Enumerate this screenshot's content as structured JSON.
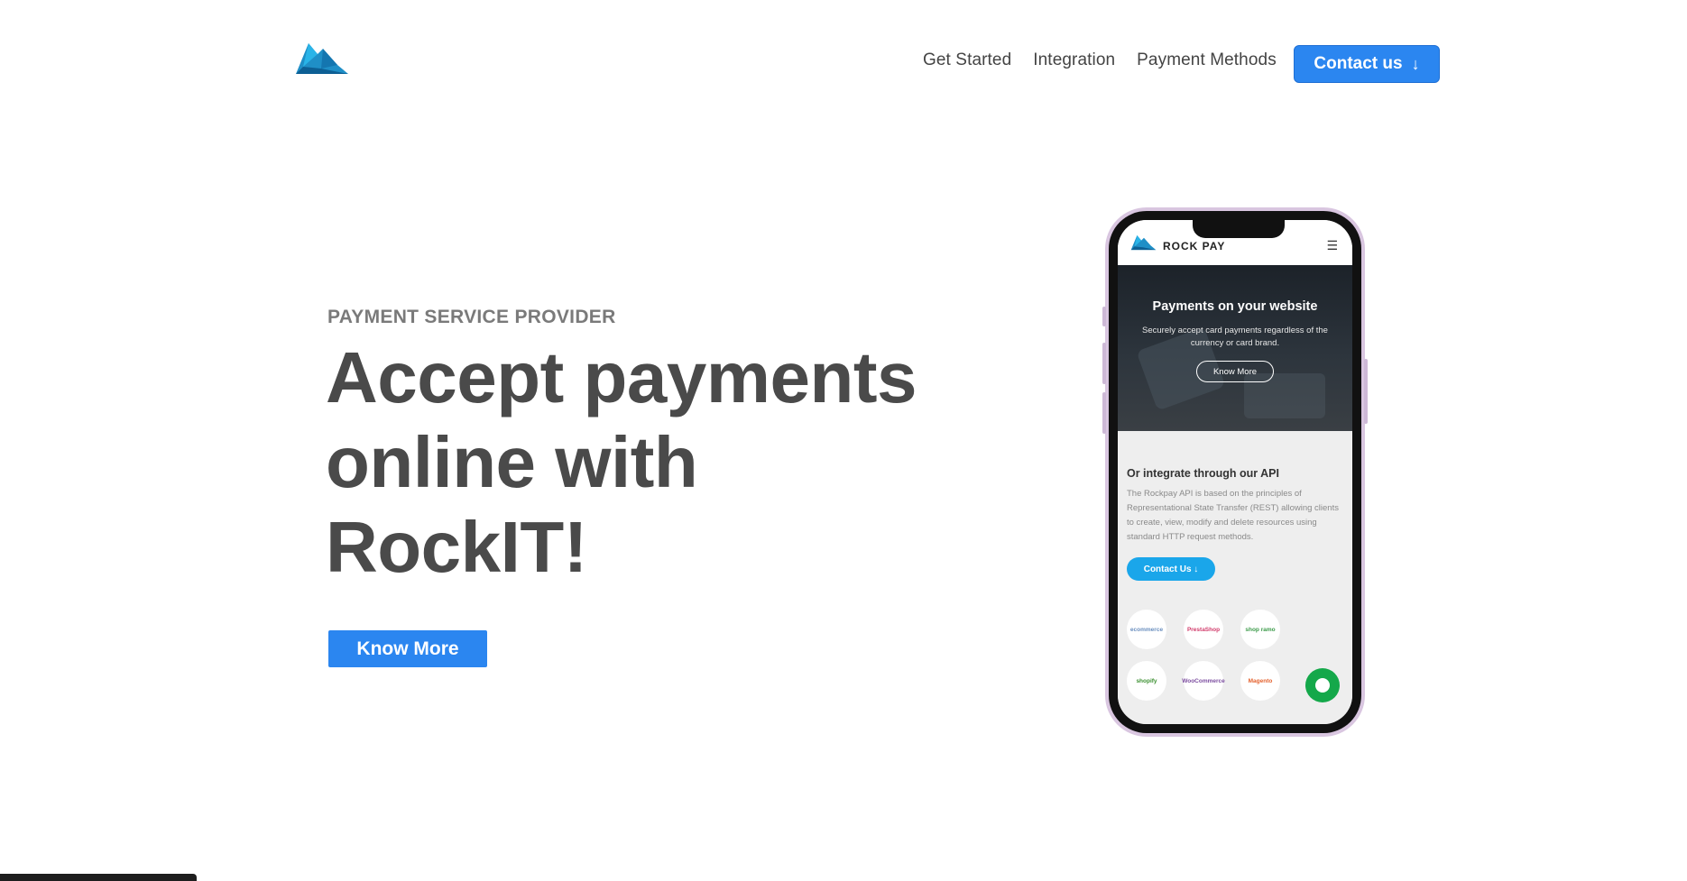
{
  "header": {
    "logo_icon": "mountain-logo-icon",
    "nav": [
      {
        "label": "Get Started"
      },
      {
        "label": "Integration"
      },
      {
        "label": "Payment Methods"
      }
    ],
    "contact_label": "Contact us",
    "contact_icon": "arrow-down-icon",
    "accent_color": "#2b86f0"
  },
  "hero": {
    "eyebrow": "PAYMENT SERVICE PROVIDER",
    "title_line1": "Accept payments",
    "title_line2": "online with",
    "title_line3": "RockIT!",
    "cta_label": "Know More"
  },
  "phone": {
    "brand": "ROCK PAY",
    "menu_icon": "hamburger-menu-icon",
    "hero_title": "Payments on your website",
    "hero_subtitle": "Securely accept card payments regardless of the currency or card brand.",
    "hero_button": "Know More",
    "api_title": "Or integrate through our API",
    "api_text": "The Rockpay API is based on the principles of Representational State Transfer (REST) allowing clients to create, view, modify and delete resources using standard HTTP request methods.",
    "contact_button": "Contact Us ↓",
    "platforms": [
      "ecommerce",
      "PrestaShop",
      "shop ramo",
      "shopify",
      "WooCommerce",
      "Magento"
    ],
    "chat_icon": "chat-bubble-icon",
    "chat_color": "#14a84a"
  }
}
